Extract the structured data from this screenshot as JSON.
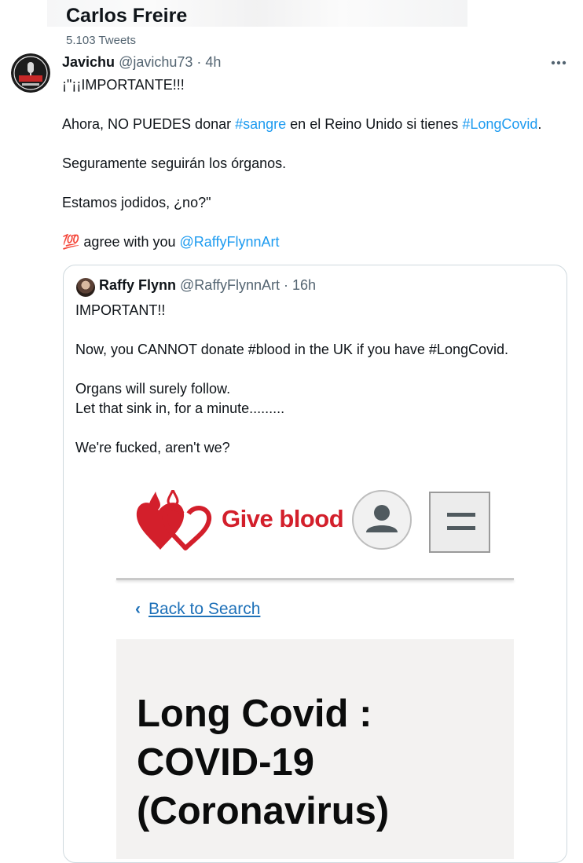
{
  "header": {
    "name": "Carlos Freire",
    "tweet_count": "5.103 Tweets"
  },
  "tweet": {
    "display_name": "Javichu",
    "handle": "@javichu73",
    "time": " · 4h",
    "lines": {
      "l1": "¡\"¡¡IMPORTANTE!!!",
      "l2_a": "Ahora, NO PUEDES donar ",
      "l2_tag1": "#sangre",
      "l2_b": " en el Reino Unido si tienes ",
      "l2_tag2": "#LongCovid",
      "l2_c": ".",
      "l3": "Seguramente seguirán los órganos.",
      "l4": "Estamos jodidos, ¿no?\"",
      "l5_emoji": "💯",
      "l5_text": " agree with you ",
      "l5_mention": "@RaffyFlynnArt"
    }
  },
  "quote": {
    "display_name": "Raffy Flynn",
    "handle": "@RaffyFlynnArt",
    "time": " · 16h",
    "lines": {
      "l1": "IMPORTANT!!",
      "l2": "Now, you CANNOT donate #blood in the UK if you have #LongCovid.",
      "l3": "Organs will surely follow.",
      "l4": "Let that sink in, for a minute.........",
      "l5": "We're fucked, aren't we?"
    },
    "media": {
      "logo_text": "Give blood",
      "back_link": "Back to Search",
      "title_1": "Long Covid :",
      "title_2": "COVID-19",
      "title_3": "(Coronavirus)",
      "brand_color": "#d31f2b",
      "link_color": "#1d70b8"
    }
  },
  "colors": {
    "link": "#1d9bf0",
    "text": "#0f1419",
    "secondary": "#536471"
  }
}
